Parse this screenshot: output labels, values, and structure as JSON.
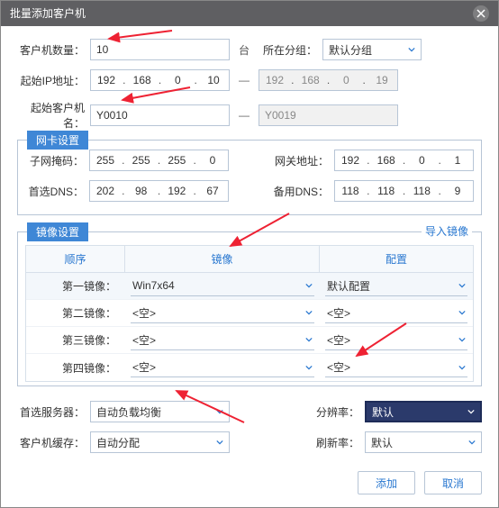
{
  "title": "批量添加客户机",
  "fields": {
    "client_count_label": "客户机数量：",
    "client_count": "10",
    "unit_tai": "台",
    "group_label": "所在分组：",
    "group_value": "默认分组",
    "start_ip_label": "起始IP地址：",
    "start_ip": [
      "192",
      "168",
      "0",
      "10"
    ],
    "end_ip": [
      "192",
      "168",
      "0",
      "19"
    ],
    "start_name_label": "起始客户机名：",
    "start_name": "Y0010",
    "end_name": "Y0019"
  },
  "nic": {
    "legend": "网卡设置",
    "subnet_label": "子网掩码：",
    "subnet": [
      "255",
      "255",
      "255",
      "0"
    ],
    "gateway_label": "网关地址：",
    "gateway": [
      "192",
      "168",
      "0",
      "1"
    ],
    "dns1_label": "首选DNS：",
    "dns1": [
      "202",
      "98",
      "192",
      "67"
    ],
    "dns2_label": "备用DNS：",
    "dns2": [
      "118",
      "118",
      "118",
      "9"
    ]
  },
  "mirror": {
    "legend": "镜像设置",
    "import": "导入镜像",
    "headers": {
      "order": "顺序",
      "mirror": "镜像",
      "config": "配置"
    },
    "rows": [
      {
        "label": "第一镜像：",
        "mirror": "Win7x64",
        "config": "默认配置"
      },
      {
        "label": "第二镜像：",
        "mirror": "<空>",
        "config": "<空>"
      },
      {
        "label": "第三镜像：",
        "mirror": "<空>",
        "config": "<空>"
      },
      {
        "label": "第四镜像：",
        "mirror": "<空>",
        "config": "<空>"
      }
    ]
  },
  "bottom": {
    "pref_server_label": "首选服务器：",
    "pref_server": "自动负载均衡",
    "resolution_label": "分辨率：",
    "resolution": "默认",
    "client_cache_label": "客户机缓存：",
    "client_cache": "自动分配",
    "refresh_label": "刷新率：",
    "refresh": "默认"
  },
  "buttons": {
    "add": "添加",
    "cancel": "取消"
  }
}
